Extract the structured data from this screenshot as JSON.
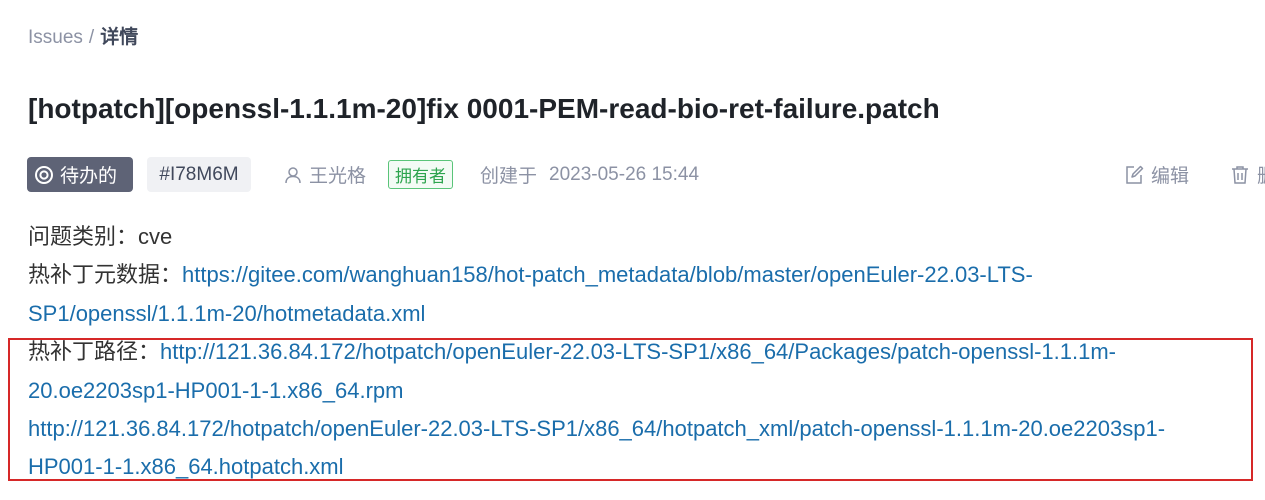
{
  "breadcrumb": {
    "parent": "Issues",
    "separator": "/",
    "current": "详情"
  },
  "issue": {
    "title": "[hotpatch][openssl-1.1.1m-20]fix 0001-PEM-read-bio-ret-failure.patch",
    "status": "待办的",
    "id": "#I78M6M",
    "author": "王光格",
    "author_role": "拥有者",
    "created_label": "创建于",
    "created_at": "2023-05-26 15:44"
  },
  "actions": {
    "edit": "编辑",
    "delete": "删"
  },
  "body": {
    "type_label": "问题类别：",
    "type_value": "cve",
    "metadata_label": "热补丁元数据：",
    "metadata_url_part1": "https://gitee.com/wanghuan158/hot-patch_metadata/blob/master/openEuler-22.03-LTS-",
    "metadata_url_part2": "SP1/openssl/1.1.1m-20/hotmetadata.xml",
    "path_label": "热补丁路径：",
    "rpm_url_part1": "http://121.36.84.172/hotpatch/openEuler-22.03-LTS-SP1/x86_64/Packages/patch-openssl-1.1.1m-",
    "rpm_url_part2": "20.oe2203sp1-HP001-1-1.x86_64.rpm",
    "xml_url_part1": "http://121.36.84.172/hotpatch/openEuler-22.03-LTS-SP1/x86_64/hotpatch_xml/patch-openssl-1.1.1m-20.oe2203sp1-",
    "xml_url_part2": "HP001-1-1.x86_64.hotpatch.xml"
  },
  "colors": {
    "status_bg": "#5e6376",
    "link": "#1a6dab",
    "owner_tag": "#2da44e",
    "highlight_border": "#d62828"
  },
  "icons": {
    "status": "status-circle-icon",
    "author": "user-icon",
    "edit": "edit-icon",
    "delete": "trash-icon"
  }
}
